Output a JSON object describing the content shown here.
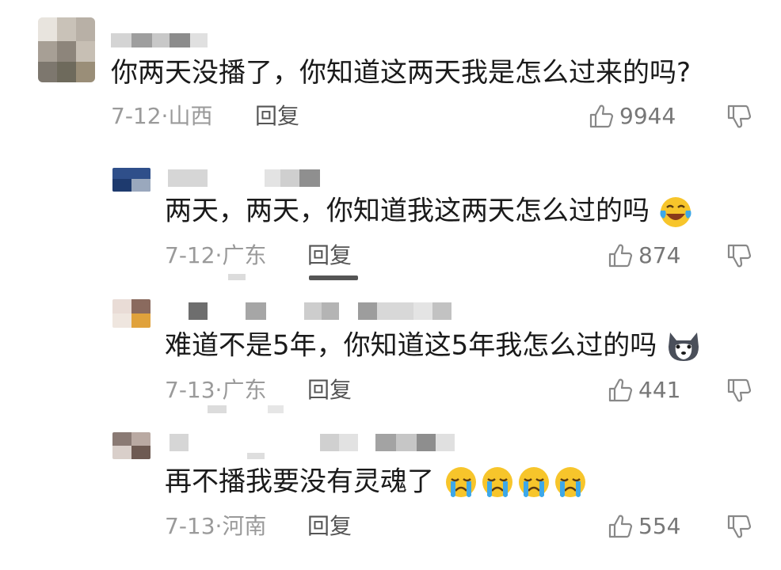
{
  "comments": [
    {
      "text": "你两天没播了，你知道这两天我是怎么过来的吗?",
      "date": "7-12",
      "region": "山西",
      "reply_label": "回复",
      "likes": "9944",
      "emojis": []
    },
    {
      "text": "两天，两天，你知道我这两天怎么过的吗",
      "date": "7-12",
      "region": "广东",
      "reply_label": "回复",
      "likes": "874",
      "emojis": [
        "laughing-crying-emoji"
      ]
    },
    {
      "text": "难道不是5年，你知道这5年我怎么过的吗",
      "date": "7-13",
      "region": "广东",
      "reply_label": "回复",
      "likes": "441",
      "emojis": [
        "husky-dog-emoji"
      ]
    },
    {
      "text": "再不播我要没有灵魂了",
      "date": "7-13",
      "region": "河南",
      "reply_label": "回复",
      "likes": "554",
      "emojis": [
        "crying-face-emoji",
        "crying-face-emoji",
        "crying-face-emoji",
        "crying-face-emoji"
      ]
    }
  ],
  "meta_separator": "·",
  "icons": {
    "like": "thumbs-up-icon",
    "dislike": "thumbs-down-icon"
  },
  "colors": {
    "text": "#1a1a1a",
    "meta": "#9a9a9a",
    "emoji_yellow": "#f7c52b",
    "tear_blue": "#3ea8e8"
  }
}
